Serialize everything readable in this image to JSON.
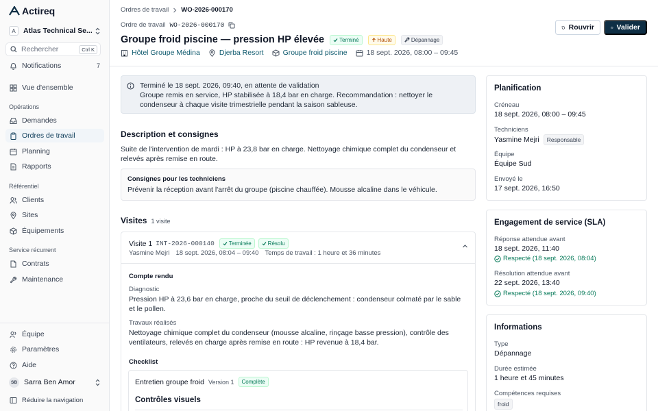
{
  "app": {
    "name": "Actireq"
  },
  "org": {
    "initial": "A",
    "name": "Atlas Technical Se..."
  },
  "search": {
    "placeholder": "Rechercher",
    "shortcut": "Ctrl K"
  },
  "nav": {
    "notifications": {
      "label": "Notifications",
      "count": "7"
    },
    "overview": "Vue d'ensemble",
    "operations_title": "Opérations",
    "operations": [
      "Demandes",
      "Ordres de travail",
      "Planning",
      "Rapports"
    ],
    "referential_title": "Référentiel",
    "referential": [
      "Clients",
      "Sites",
      "Équipements"
    ],
    "recurring_title": "Service récurrent",
    "recurring": [
      "Contrats",
      "Maintenance"
    ],
    "bottom": [
      "Équipe",
      "Paramètres",
      "Aide"
    ],
    "collapse": "Réduire la navigation"
  },
  "user": {
    "initials": "SB",
    "name": "Sarra Ben Amor"
  },
  "breadcrumb": {
    "parent": "Ordres de travail",
    "current": "WO-2026-000170"
  },
  "wo": {
    "label": "Ordre de travail",
    "code": "WO-2026-000170"
  },
  "title": "Groupe froid piscine — pression HP élevée",
  "badges": {
    "status": "Terminé",
    "priority": "Haute",
    "type": "Dépannage"
  },
  "meta": {
    "client": "Hôtel Groupe Médina",
    "site": "Djerba Resort",
    "equipment": "Groupe froid piscine",
    "schedule": "18 sept. 2026, 08:00 – 09:45"
  },
  "actions": {
    "reopen": "Rouvrir",
    "validate": "Valider"
  },
  "alert": {
    "title": "Terminé le 18 sept. 2026, 09:40, en attente de validation",
    "body": "Groupe remis en service, HP stabilisée à 18,4 bar en charge. Recommandation : nettoyer le condenseur à chaque visite trimestrielle pendant la saison sableuse."
  },
  "description": {
    "title": "Description et consignes",
    "text": "Suite de l'intervention de mardi : HP à 23,8 bar en charge. Nettoyage chimique complet du condenseur et relevés après remise en route.",
    "instructions_title": "Consignes pour les techniciens",
    "instructions": "Prévenir la réception avant l'arrêt du groupe (piscine chauffée). Mousse alcaline dans le véhicule."
  },
  "visits": {
    "title": "Visites",
    "count": "1 visite",
    "items": [
      {
        "title": "Visite 1",
        "code": "INT-2026-000140",
        "status": "Terminée",
        "result": "Résolu",
        "technician": "Yasmine Mejri",
        "time": "18 sept. 2026, 08:04 – 09:40",
        "duration": "Temps de travail : 1 heure et 36 minutes",
        "report_title": "Compte rendu",
        "diagnostic_label": "Diagnostic",
        "diagnostic": "Pression HP à 23,6 bar en charge, proche du seuil de déclenchement : condenseur colmaté par le sable et le pollen.",
        "work_label": "Travaux réalisés",
        "work": "Nettoyage chimique complet du condenseur (mousse alcaline, rinçage basse pression), contrôle des ventilateurs, relevés en charge après remise en route : HP revenue à 18,4 bar.",
        "checklist_title": "Checklist",
        "checklist": {
          "name": "Entretien groupe froid",
          "version": "Version 1",
          "status": "Complète",
          "section": "Contrôles visuels"
        }
      }
    ]
  },
  "planning": {
    "title": "Planification",
    "slot_label": "Créneau",
    "slot": "18 sept. 2026, 08:00 – 09:45",
    "tech_label": "Techniciens",
    "tech": "Yasmine Mejri",
    "tech_role": "Responsable",
    "team_label": "Équipe",
    "team": "Équipe Sud",
    "sent_label": "Envoyé le",
    "sent": "17 sept. 2026, 16:50"
  },
  "sla": {
    "title": "Engagement de service (SLA)",
    "response_label": "Réponse attendue avant",
    "response": "18 sept. 2026, 11:40",
    "response_status": "Respecté (18 sept. 2026, 08:04)",
    "resolution_label": "Résolution attendue avant",
    "resolution": "22 sept. 2026, 13:40",
    "resolution_status": "Respecté (18 sept. 2026, 09:40)"
  },
  "info": {
    "title": "Informations",
    "type_label": "Type",
    "type": "Dépannage",
    "duration_label": "Durée estimée",
    "duration": "1 heure et 45 minutes",
    "skills_label": "Compétences requises",
    "skill": "froid"
  },
  "colors": {
    "primary": "#0f2f45",
    "link": "#0f5a6e",
    "success": "#047857",
    "warning": "#b45309"
  }
}
